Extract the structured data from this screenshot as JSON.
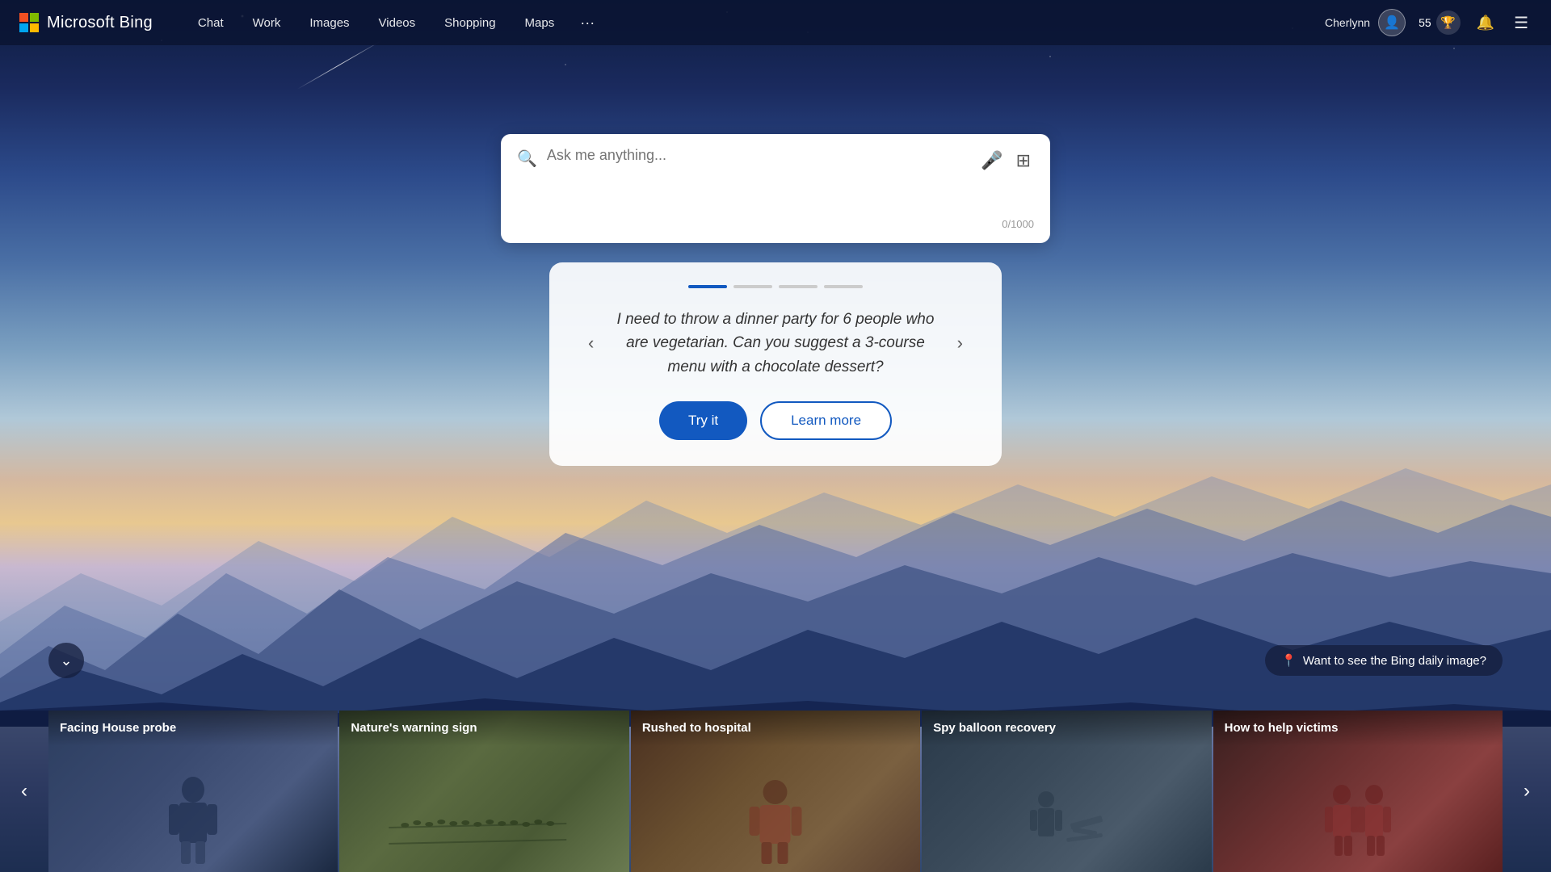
{
  "app": {
    "title": "Microsoft Bing"
  },
  "navbar": {
    "brand": "Microsoft Bing",
    "nav_items": [
      {
        "label": "Chat",
        "id": "chat"
      },
      {
        "label": "Work",
        "id": "work"
      },
      {
        "label": "Images",
        "id": "images"
      },
      {
        "label": "Videos",
        "id": "videos"
      },
      {
        "label": "Shopping",
        "id": "shopping"
      },
      {
        "label": "Maps",
        "id": "maps"
      }
    ],
    "more_label": "···",
    "username": "Cherlynn",
    "points": "55",
    "trophy_char": "🏆",
    "bell_char": "🔔",
    "menu_char": "☰"
  },
  "search": {
    "placeholder": "Ask me anything...",
    "char_count": "0/1000",
    "mic_char": "🎤",
    "camera_char": "⊞"
  },
  "suggestion_card": {
    "text": "I need to throw a dinner party for 6 people who are vegetarian. Can you suggest a 3-course menu with a chocolate dessert?",
    "try_label": "Try it",
    "learn_label": "Learn more",
    "dots": [
      {
        "active": true
      },
      {
        "active": false
      },
      {
        "active": false
      },
      {
        "active": false
      }
    ]
  },
  "bottom_bar": {
    "scroll_down_char": "⌄",
    "daily_image_text": "Want to see the Bing daily image?",
    "location_char": "📍"
  },
  "news": {
    "prev_char": "‹",
    "next_char": "›",
    "cards": [
      {
        "title": "Facing House probe",
        "id": "card-1"
      },
      {
        "title": "Nature's warning sign",
        "id": "card-2"
      },
      {
        "title": "Rushed to hospital",
        "id": "card-3"
      },
      {
        "title": "Spy balloon recovery",
        "id": "card-4"
      },
      {
        "title": "How to help victims",
        "id": "card-5"
      }
    ]
  }
}
